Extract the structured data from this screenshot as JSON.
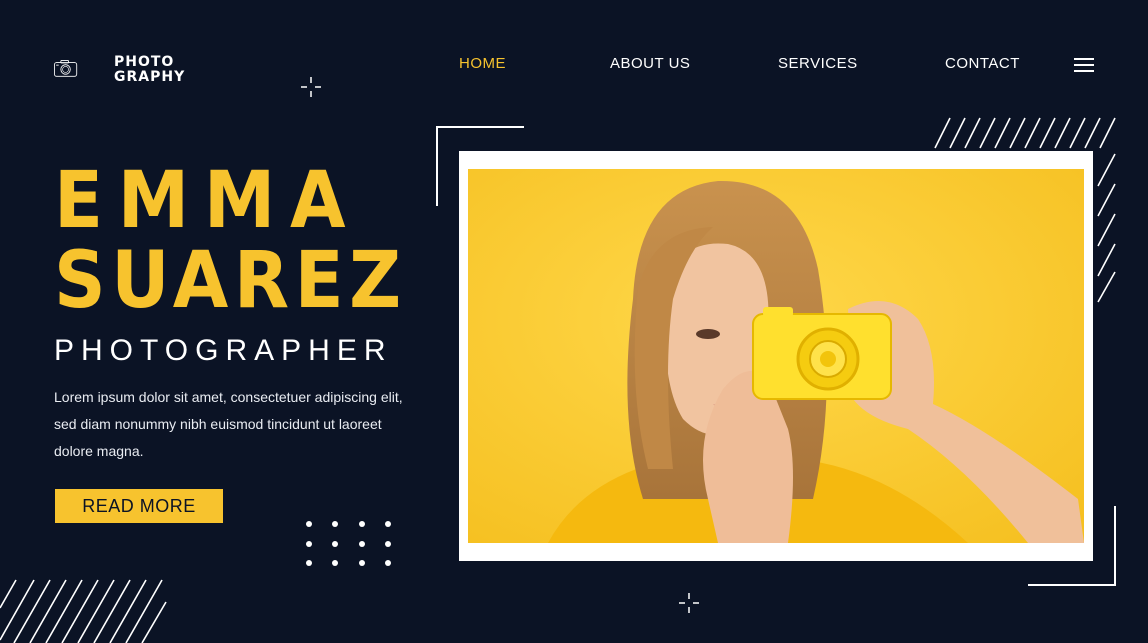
{
  "logo": {
    "line1": "PHOTO",
    "line2": "GRAPHY",
    "icon": "camera-icon"
  },
  "nav": {
    "items": [
      {
        "label": "HOME",
        "active": true
      },
      {
        "label": "ABOUT US",
        "active": false
      },
      {
        "label": "SERVICES",
        "active": false
      },
      {
        "label": "CONTACT",
        "active": false
      }
    ],
    "menu_icon": "hamburger-icon"
  },
  "hero": {
    "first_name": "EMMA",
    "last_name": "SUAREZ",
    "role": "PHOTOGRAPHER",
    "description": "Lorem ipsum dolor sit amet, consectetuer adipiscing elit, sed diam nonummy nibh euismod tincidunt ut laoreet dolore magna.",
    "button_label": "READ MORE"
  },
  "colors": {
    "background": "#0b1325",
    "accent": "#f7c32e",
    "text": "#ffffff"
  }
}
